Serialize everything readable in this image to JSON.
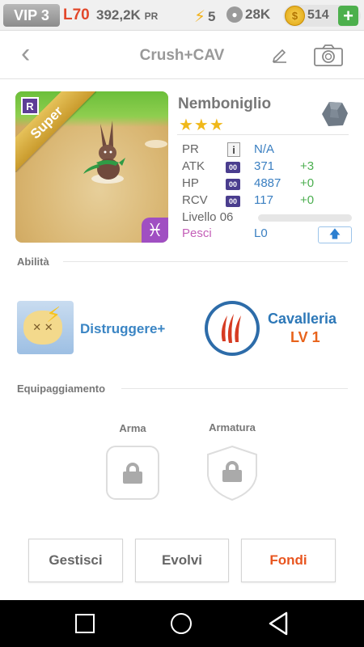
{
  "topbar": {
    "vip": "VIP 3",
    "level": "L70",
    "power": "392,2K",
    "power_unit": "PR",
    "energy": "5",
    "paws": "28K",
    "coins": "514",
    "add": "+"
  },
  "header": {
    "title": "Crush+CAV",
    "back": "‹"
  },
  "card": {
    "rarity": "Super",
    "tag": "R",
    "zodiac": "♓"
  },
  "monster": {
    "name": "Nemboniglio",
    "stars": "★★★",
    "stats": {
      "pr_label": "PR",
      "pr_value": "N/A",
      "atk_label": "ATK",
      "atk_badge": "00",
      "atk_value": "371",
      "atk_bonus": "+3",
      "hp_label": "HP",
      "hp_badge": "00",
      "hp_value": "4887",
      "hp_bonus": "+0",
      "rcv_label": "RCV",
      "rcv_badge": "00",
      "rcv_value": "117",
      "rcv_bonus": "+0",
      "level_label": "Livello 06",
      "level_progress": 0,
      "sign_label": "Pesci",
      "sign_value": "L0"
    }
  },
  "abilities": {
    "section_title": "Abilità",
    "skill1_name": "Distruggere+",
    "skill2_name": "Cavalleria",
    "skill2_level": "LV 1"
  },
  "equipment": {
    "section_title": "Equipaggiamento",
    "weapon_label": "Arma",
    "armor_label": "Armatura"
  },
  "actions": {
    "manage": "Gestisci",
    "evolve": "Evolvi",
    "merge": "Fondi"
  },
  "colors": {
    "accent_blue": "#3a7fc1",
    "bonus_green": "#4caf50",
    "fondi_orange": "#e8551f",
    "level_red": "#e2472a",
    "star_gold": "#f0b81a"
  }
}
